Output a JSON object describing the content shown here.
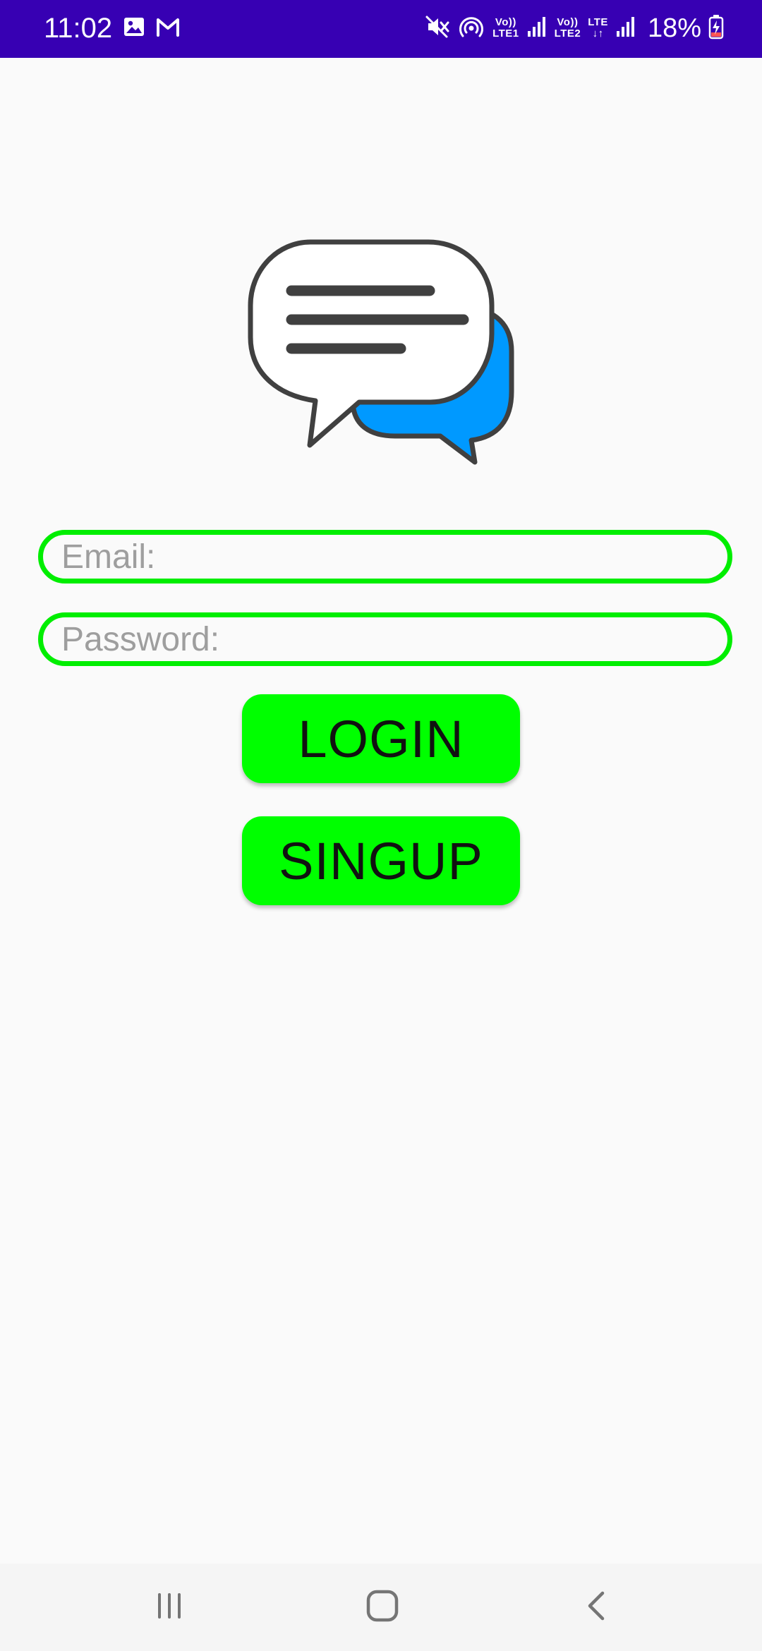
{
  "status_bar": {
    "time": "11:02",
    "left_icons": [
      "image-icon",
      "gmail-icon"
    ],
    "right_icons": [
      "mute-icon",
      "hotspot-icon",
      "signal-sim1-icon",
      "signal-sim2-icon",
      "battery-charging-icon"
    ],
    "sim1_top": "Vo))",
    "sim1_bottom": "LTE1",
    "sim2_top": "Vo))",
    "sim2_bottom": "LTE2",
    "data_top": "LTE",
    "data_bottom": "↓↑",
    "battery": "18%"
  },
  "logo": {
    "icon": "chat-bubbles-icon",
    "accent_color": "#0099ff"
  },
  "form": {
    "email_placeholder": "Email:",
    "email_value": "",
    "password_placeholder": "Password:",
    "password_value": ""
  },
  "buttons": {
    "login_label": "LOGIN",
    "signup_label": "SINGUP"
  },
  "colors": {
    "status_bar": "#3700b3",
    "field_border": "#00ee00",
    "button_bg": "#00ff00"
  },
  "nav_bar": {
    "recents_icon": "recents-icon",
    "home_icon": "home-icon",
    "back_icon": "back-icon"
  }
}
